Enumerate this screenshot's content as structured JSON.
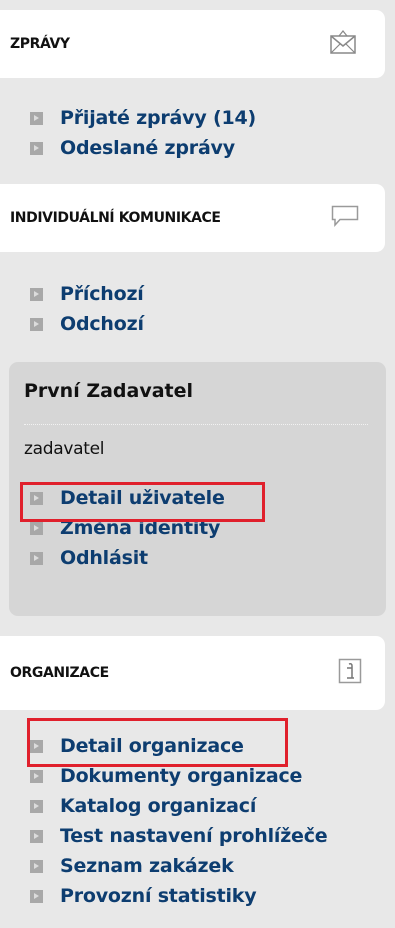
{
  "messages": {
    "title": "ZPRÁVY",
    "icon": "envelope-icon",
    "items": [
      {
        "label": "Přijaté zprávy (14)"
      },
      {
        "label": "Odeslané zprávy"
      }
    ]
  },
  "communication": {
    "title": "INDIVIDUÁLNÍ KOMUNIKACE",
    "icon": "speech-bubble-icon",
    "items": [
      {
        "label": "Příchozí"
      },
      {
        "label": "Odchozí"
      }
    ]
  },
  "user": {
    "name": "První Zadavatel",
    "role": "zadavatel",
    "items": [
      {
        "label": "Detail uživatele",
        "highlighted": true
      },
      {
        "label": "Změna identity"
      },
      {
        "label": "Odhlásit"
      }
    ]
  },
  "organization": {
    "title": "ORGANIZACE",
    "icon": "info-icon",
    "items": [
      {
        "label": "Detail organizace",
        "highlighted": true
      },
      {
        "label": "Dokumenty organizace"
      },
      {
        "label": "Katalog organizací"
      },
      {
        "label": "Test nastavení prohlížeče"
      },
      {
        "label": "Seznam zakázek"
      },
      {
        "label": "Provozní statistiky"
      }
    ]
  },
  "colors": {
    "link": "#0d3d70",
    "highlight": "#e0202c",
    "panel": "#d6d6d6",
    "background": "#e8e8e8"
  }
}
